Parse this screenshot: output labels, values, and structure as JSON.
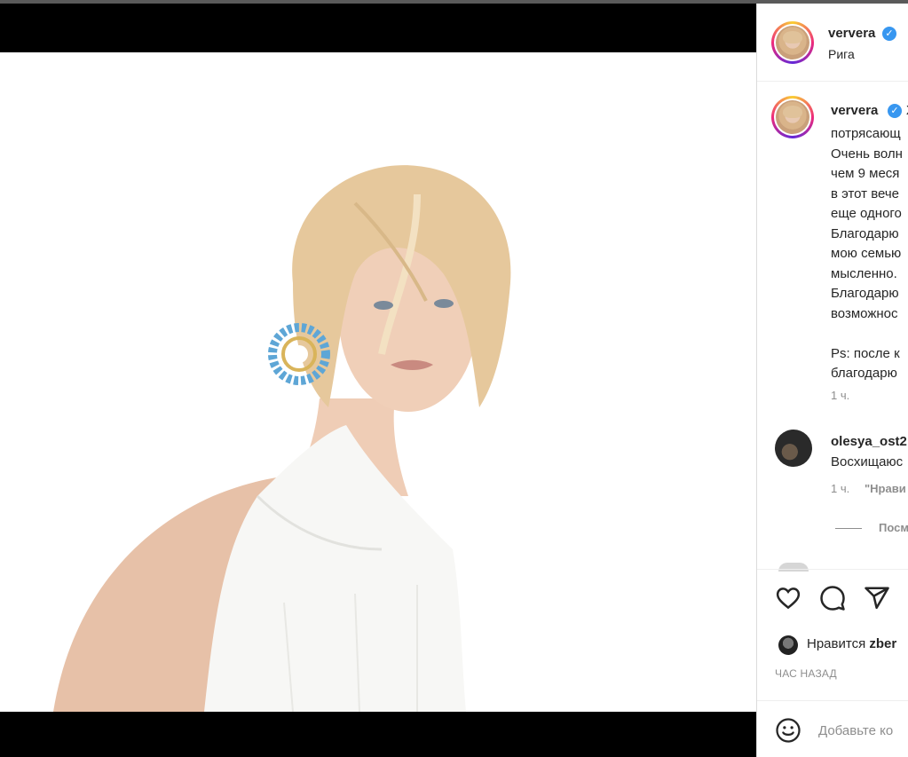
{
  "post": {
    "username": "ververa",
    "location": "Рига"
  },
  "caption": {
    "username": "ververa",
    "lines": [
      "Ж",
      "потрясающ",
      "Очень волн",
      "чем 9 меся",
      "в этот вече",
      "еще одного",
      "Благодарю",
      "мою семью",
      "мысленно.",
      "Благодарю",
      "возможнос",
      "",
      "Ps: после к",
      "благодарю"
    ],
    "time": "1 ч."
  },
  "comment": {
    "username": "olesya_ost2",
    "text": "Восхищаюс",
    "time": "1 ч.",
    "like_label": "\"Нрави",
    "view_replies": "Посм"
  },
  "likes": {
    "prefix": "Нравится",
    "user": "zber"
  },
  "time_ago": "ЧАС НАЗАД",
  "comment_input": {
    "placeholder": "Добавьте ко"
  },
  "colors": {
    "verified": "#3897f0",
    "text": "#262626",
    "meta": "#8e8e8e"
  },
  "icons": [
    "heart-icon",
    "comment-icon",
    "share-icon",
    "emoji-icon",
    "verified-icon"
  ]
}
